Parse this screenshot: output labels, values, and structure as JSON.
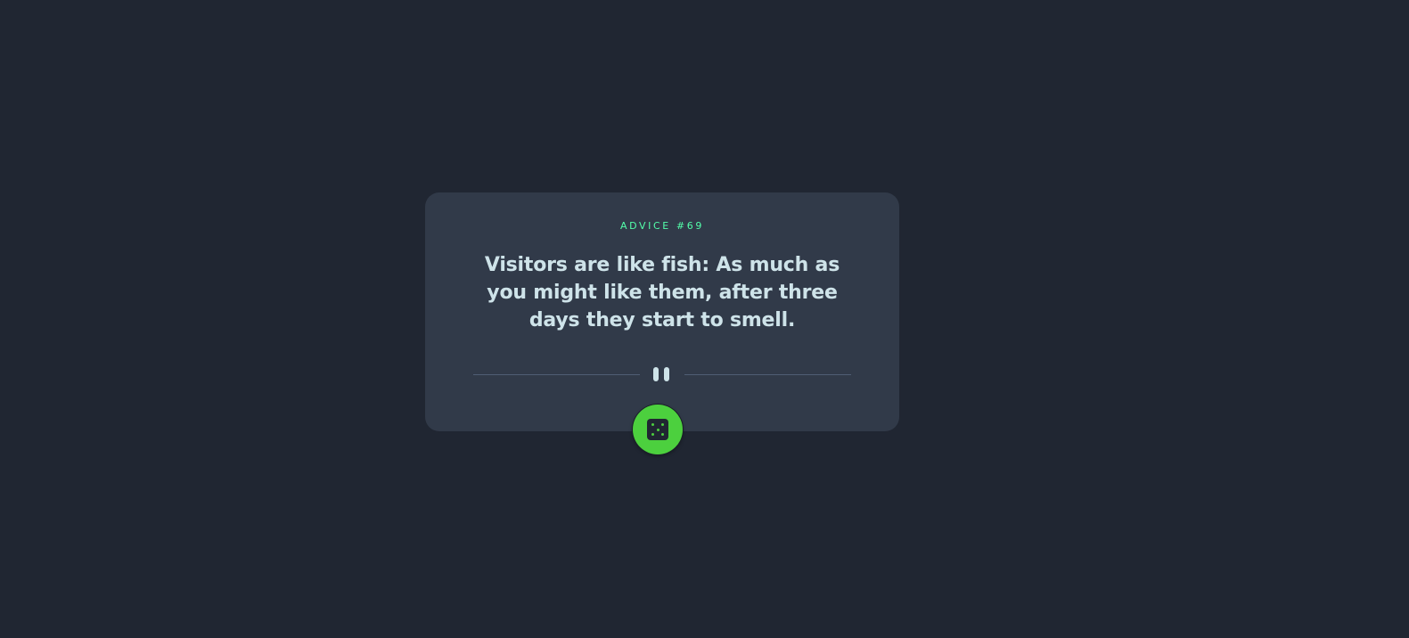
{
  "card": {
    "advice_label": "ADVICE #69",
    "quote": "Visitors are like fish: As much as you might like them, after three days they start to smell."
  },
  "divider": {
    "icon": "pause-icon"
  },
  "dice_button": {
    "icon": "dice-icon",
    "accent_color": "#4cd03e"
  },
  "colors": {
    "background": "#202632",
    "card": "#313a49",
    "accent_label": "#53ffaa",
    "text": "#cee3e9",
    "divider": "#4f5d74"
  }
}
